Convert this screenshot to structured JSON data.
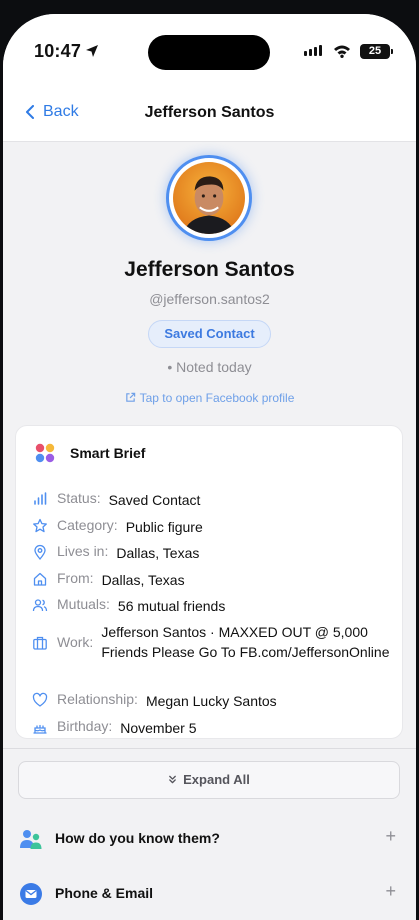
{
  "status_bar": {
    "time": "10:47",
    "battery": "25"
  },
  "nav": {
    "back_label": "Back",
    "title": "Jefferson Santos"
  },
  "profile": {
    "name": "Jefferson Santos",
    "handle": "@jefferson.santos2",
    "badge": "Saved Contact",
    "noted": "• Noted today",
    "facebook_link": "Tap to open Facebook profile"
  },
  "brief": {
    "title": "Smart Brief",
    "rows": [
      {
        "icon": "bar-chart-icon",
        "label": "Status:",
        "value": "Saved Contact"
      },
      {
        "icon": "star-icon",
        "label": "Category:",
        "value": "Public figure"
      },
      {
        "icon": "location-pin-icon",
        "label": "Lives in:",
        "value": "Dallas, Texas"
      },
      {
        "icon": "home-icon",
        "label": "From:",
        "value": "Dallas, Texas"
      },
      {
        "icon": "people-icon",
        "label": "Mutuals:",
        "value": "56 mutual friends"
      },
      {
        "icon": "briefcase-icon",
        "label": "Work:",
        "value": "Jefferson Santos · MAXXED OUT @ 5,000 Friends Please Go To FB.com/JeffersonOnline"
      },
      {
        "icon": "heart-icon",
        "label": "Relationship:",
        "value": "Megan Lucky Santos"
      },
      {
        "icon": "cake-icon",
        "label": "Birthday:",
        "value": "November 5"
      }
    ]
  },
  "expand_all": "Expand All",
  "sections": [
    {
      "title": "How do you know them?",
      "icon": "people-color-icon",
      "action": "+"
    },
    {
      "title": "Phone & Email",
      "icon": "mail-circle-icon",
      "action": "+"
    }
  ],
  "colors": {
    "accent": "#2f7be5",
    "ring": "#4f8ff0",
    "pill_bg": "#e6eefb",
    "muted": "#8e8e94"
  }
}
